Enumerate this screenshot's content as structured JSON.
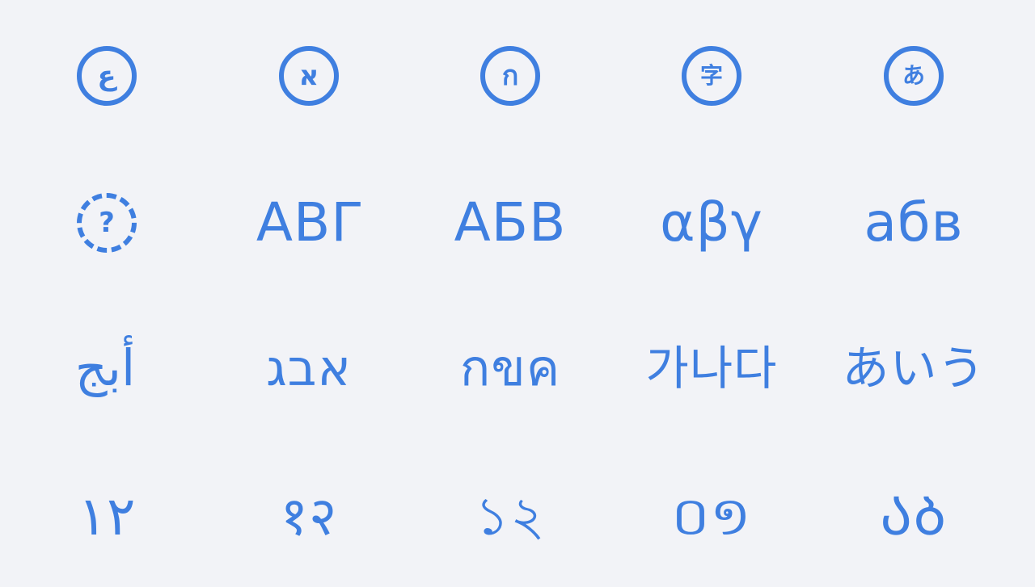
{
  "row1": [
    {
      "icon": "arabic-character-circle-icon",
      "glyph": "ع"
    },
    {
      "icon": "hebrew-character-circle-icon",
      "glyph": "א"
    },
    {
      "icon": "thai-character-circle-icon",
      "glyph": "ก"
    },
    {
      "icon": "chinese-character-circle-icon",
      "glyph": "字"
    },
    {
      "icon": "japanese-character-circle-icon",
      "glyph": "あ"
    }
  ],
  "row2": [
    {
      "icon": "unknown-character-dashed-circle-icon",
      "glyph": "?"
    },
    {
      "icon": "greek-uppercase-icon",
      "text": "ΑΒΓ"
    },
    {
      "icon": "cyrillic-uppercase-icon",
      "text": "АБВ"
    },
    {
      "icon": "greek-lowercase-icon",
      "text": "αβγ"
    },
    {
      "icon": "cyrillic-lowercase-icon",
      "text": "абв"
    }
  ],
  "row3": [
    {
      "icon": "arabic-letters-icon",
      "text": "أبج"
    },
    {
      "icon": "hebrew-letters-icon",
      "text": "אבג"
    },
    {
      "icon": "thai-letters-icon",
      "text": "กขค"
    },
    {
      "icon": "korean-letters-icon",
      "text": "가나다"
    },
    {
      "icon": "japanese-letters-icon",
      "text": "あいう"
    }
  ],
  "row4": [
    {
      "icon": "arabic-numerals-icon",
      "text": "١٢"
    },
    {
      "icon": "devanagari-numerals-icon",
      "text": "१२"
    },
    {
      "icon": "bengali-numerals-icon",
      "text": "১২"
    },
    {
      "icon": "khmer-numerals-icon",
      "text": "០១"
    },
    {
      "icon": "georgian-letters-icon",
      "text": "ᲐᲑ"
    }
  ],
  "accent_color": "#3f7fe0",
  "background_color": "#f2f3f7"
}
